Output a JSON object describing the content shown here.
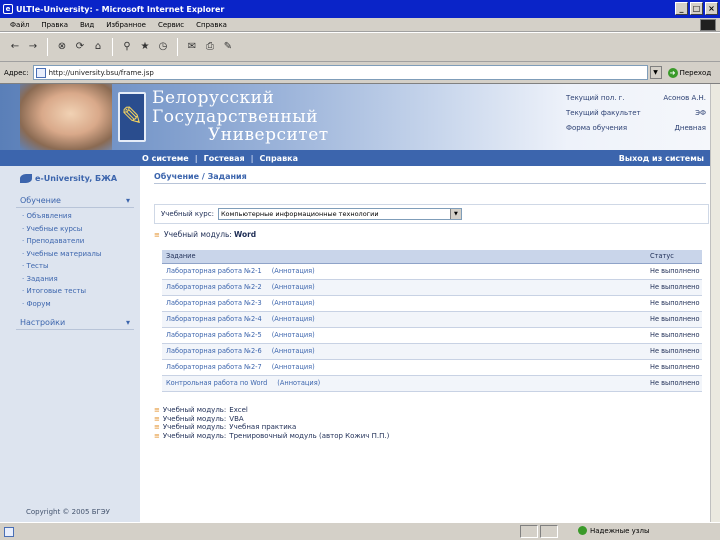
{
  "window": {
    "title": "ULTIe-University: - Microsoft Internet Explorer",
    "btn_min": "_",
    "btn_max": "□",
    "btn_close": "×"
  },
  "menu": [
    "Файл",
    "Правка",
    "Вид",
    "Избранное",
    "Сервис",
    "Справка"
  ],
  "toolbar": {
    "back": "←",
    "forward": "→",
    "stop": "⊗",
    "refresh": "⟳",
    "home": "⌂",
    "search": "⚲",
    "favorites": "★",
    "history": "◷",
    "mail": "✉",
    "print": "⎙",
    "edit": "✎"
  },
  "address": {
    "label": "Адрес:",
    "url": "http://university.bsu/frame.jsp",
    "go_label": "Переход",
    "dropdown": "▼"
  },
  "banner": {
    "uni_line1": "Белорусский",
    "uni_line2": "Государственный",
    "uni_line3": "Университет",
    "user_label": "Текущий пол. г.",
    "user_name": "Асонов А.Н.",
    "faculty_label": "Текущий факультет",
    "faculty_value": "ЭФ",
    "form_label": "Форма обучения",
    "form_value": "Дневная",
    "crest": "✎"
  },
  "nav": {
    "links": [
      "О системе",
      "Гостевая",
      "Справка"
    ],
    "sep": "|",
    "logout": "Выход из системы"
  },
  "sidebar": {
    "brand": "e-University, БЖА",
    "section1": "Обучение",
    "section1_arrow": "▾",
    "items": [
      "Объявления",
      "Учебные курсы",
      "Преподаватели",
      "Учебные материалы",
      "Тесты",
      "Задания",
      "Итоговые тесты",
      "Форум"
    ],
    "section2": "Настройки",
    "section2_arrow": "▾",
    "copyright": "Copyright © 2005 БГЭУ"
  },
  "main": {
    "breadcrumb": "Обучение / Задания",
    "course_label": "Учебный курс:",
    "course_value": "Компьютерные информационные технологии",
    "course_arrow": "▼",
    "module_label": "Учебный модуль:",
    "module_name": "Word",
    "module_icon": "≡",
    "table_headers": [
      "Задание",
      "Статус"
    ],
    "tasks": [
      {
        "name": "Лабораторная работа №2-1",
        "ann": "(Аннотация)",
        "status": "Не выполнено"
      },
      {
        "name": "Лабораторная работа №2-2",
        "ann": "(Аннотация)",
        "status": "Не выполнено"
      },
      {
        "name": "Лабораторная работа №2-3",
        "ann": "(Аннотация)",
        "status": "Не выполнено"
      },
      {
        "name": "Лабораторная работа №2-4",
        "ann": "(Аннотация)",
        "status": "Не выполнено"
      },
      {
        "name": "Лабораторная работа №2-5",
        "ann": "(Аннотация)",
        "status": "Не выполнено"
      },
      {
        "name": "Лабораторная работа №2-6",
        "ann": "(Аннотация)",
        "status": "Не выполнено"
      },
      {
        "name": "Лабораторная работа №2-7",
        "ann": "(Аннотация)",
        "status": "Не выполнено"
      },
      {
        "name": "Контрольная работа по Word",
        "ann": "(Аннотация)",
        "status": "Не выполнено"
      }
    ],
    "other_modules": [
      {
        "label": "Учебный модуль:",
        "name": "Excel"
      },
      {
        "label": "Учебный модуль:",
        "name": "VBA"
      },
      {
        "label": "Учебный модуль:",
        "name": "Учебная практика"
      },
      {
        "label": "Учебный модуль:",
        "name": "Тренировочный модуль (автор Кожич П.П.)"
      }
    ],
    "other_icon": "≡"
  },
  "status": {
    "zone": "Надежные узлы"
  }
}
